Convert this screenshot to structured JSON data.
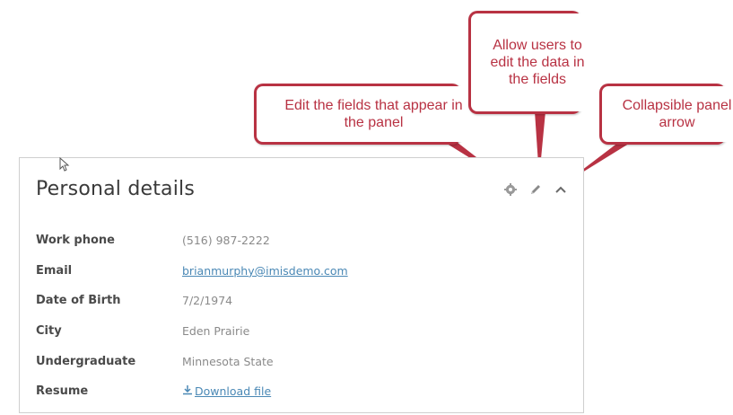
{
  "panel": {
    "title": "Personal details",
    "fields": [
      {
        "label": "Work phone",
        "value": "(516) 987-2222",
        "type": "text"
      },
      {
        "label": "Email",
        "value": "brianmurphy@imisdemo.com",
        "type": "link"
      },
      {
        "label": "Date of Birth",
        "value": "7/2/1974",
        "type": "text"
      },
      {
        "label": "City",
        "value": "Eden Prairie",
        "type": "text"
      },
      {
        "label": "Undergraduate",
        "value": "Minnesota State",
        "type": "text"
      },
      {
        "label": "Resume",
        "value": "Download file",
        "type": "download"
      }
    ]
  },
  "callouts": {
    "edit_fields": "Edit the fields that appear in the panel",
    "edit_data": "Allow users to edit the data in the fields",
    "collapse": "Collapsible panel arrow"
  },
  "icons": {
    "settings": "gear-icon",
    "edit": "pencil-icon",
    "collapse": "chevron-up-icon",
    "download": "download-icon",
    "cursor": "mouse-pointer-icon"
  },
  "colors": {
    "callout": "#b83243",
    "link": "#4a88b5",
    "icon": "#8a8a8a"
  }
}
